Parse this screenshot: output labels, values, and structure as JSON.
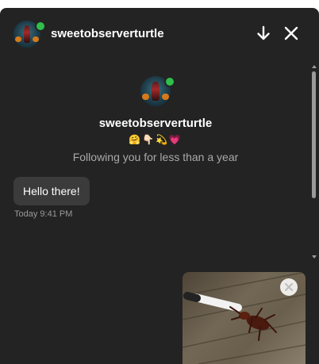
{
  "header": {
    "username": "sweetobserverturtle",
    "download_icon": "arrow-down-icon",
    "close_icon": "close-icon"
  },
  "profile": {
    "username": "sweetobserverturtle",
    "emojis": "🤗👇🏻💫💗",
    "following_text": "Following you for less than a year"
  },
  "messages": [
    {
      "text": "Hello there!",
      "time": "Today 9:41 PM"
    }
  ],
  "media": {
    "close_icon": "close-icon"
  },
  "colors": {
    "background": "#232323",
    "bubble": "#3b3b3b",
    "online": "#2fbf4a",
    "muted_text": "#a9a9a9"
  }
}
